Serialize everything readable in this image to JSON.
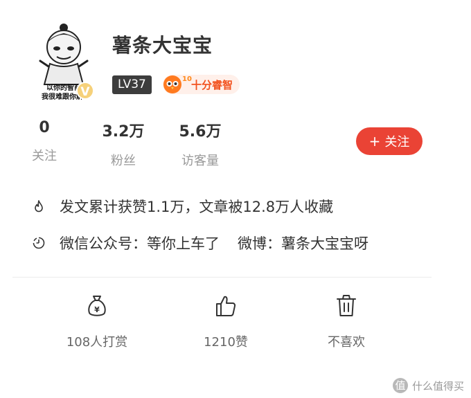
{
  "profile": {
    "name": "薯条大宝宝",
    "avatar_caption": [
      "以你的智商",
      "我很难跟你解"
    ],
    "avatar_verified": "V",
    "level": "LV37",
    "smart_badge": {
      "number": "10",
      "label": "十分睿智"
    }
  },
  "stats": [
    {
      "value": "0",
      "label": "关注"
    },
    {
      "value": "3.2万",
      "label": "粉丝"
    },
    {
      "value": "5.6万",
      "label": "访客量"
    }
  ],
  "follow_button": {
    "icon": "+",
    "label": "关注"
  },
  "info": {
    "likes_text": "发文累计获赞1.1万，文章被12.8万人收藏",
    "wechat_text": "微信公众号：等你上车了",
    "weibo_text": "微博：薯条大宝宝呀"
  },
  "actions": [
    {
      "icon": "money-bag-icon",
      "label": "108人打赏"
    },
    {
      "icon": "thumbs-up-icon",
      "label": "1210赞"
    },
    {
      "icon": "trash-icon",
      "label": "不喜欢"
    }
  ],
  "watermark": {
    "icon": "值",
    "text": "什么值得买"
  },
  "colors": {
    "follow": "#ea4335",
    "badge_dark": "#3d3d3d",
    "smart": "#f2521f"
  }
}
